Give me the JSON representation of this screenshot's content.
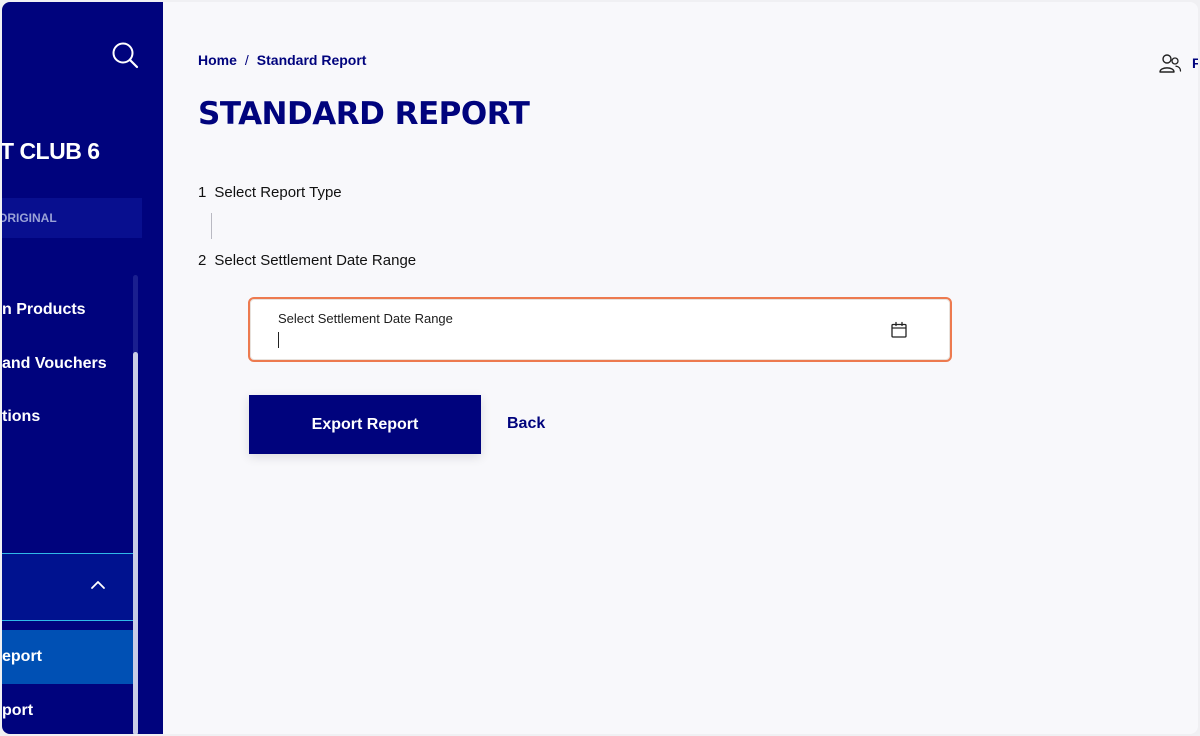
{
  "sidebar": {
    "club_name": "T CLUB 6",
    "tag": "ORIGINAL",
    "items": [
      {
        "label": "n Products"
      },
      {
        "label": "and Vouchers"
      },
      {
        "label": "tions"
      }
    ],
    "sub_items": [
      {
        "label": "eport",
        "active": true
      },
      {
        "label": "port",
        "active": false
      }
    ],
    "icons": {
      "search": "search-icon",
      "chevron": "chevron-up-icon"
    }
  },
  "breadcrumb": {
    "home": "Home",
    "separator": "/",
    "current": "Standard Report"
  },
  "user": {
    "icon": "users-icon",
    "label": "F"
  },
  "page": {
    "title": "STANDARD REPORT"
  },
  "steps": [
    {
      "number": "1",
      "label": "Select Report Type"
    },
    {
      "number": "2",
      "label": "Select Settlement Date Range"
    }
  ],
  "date_field": {
    "label": "Select Settlement Date Range",
    "value": "",
    "icon": "calendar-icon"
  },
  "actions": {
    "export": "Export Report",
    "back": "Back"
  },
  "colors": {
    "brand_navy": "#00037d",
    "active_blue": "#0050b4",
    "focus_orange": "#ed7a4f",
    "expanded_border": "#2fb8e8",
    "page_background": "#f8f8fb"
  }
}
